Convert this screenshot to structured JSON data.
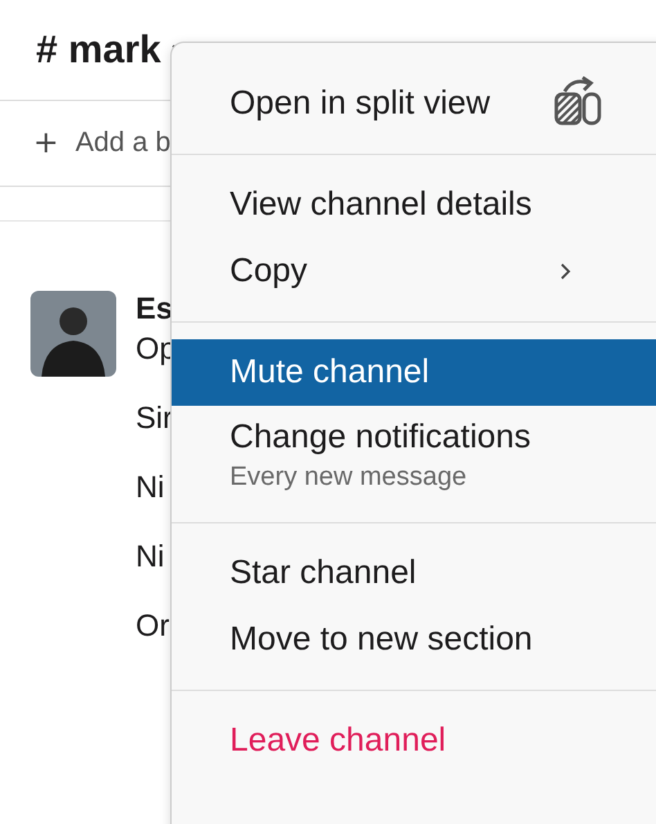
{
  "channel": {
    "title": "# mark"
  },
  "bookmark": {
    "icon": "+",
    "label": "Add a b"
  },
  "message": {
    "author": "Es",
    "lines": [
      "Op",
      "Sir",
      "Ni",
      "Ni",
      "Or"
    ]
  },
  "menu": {
    "items": [
      {
        "kind": "item",
        "label": "Open in split view",
        "selected": false
      },
      {
        "kind": "divider"
      },
      {
        "kind": "item",
        "label": "View channel details",
        "selected": false
      },
      {
        "kind": "item",
        "label": "Copy",
        "submenu": true,
        "selected": false
      },
      {
        "kind": "divider"
      },
      {
        "kind": "item",
        "label": "Mute channel",
        "selected": true
      },
      {
        "kind": "item",
        "label": "Change notifications",
        "sub": "Every new message",
        "selected": false
      },
      {
        "kind": "divider"
      },
      {
        "kind": "item",
        "label": "Star channel",
        "selected": false
      },
      {
        "kind": "item",
        "label": "Move to new section",
        "selected": false
      },
      {
        "kind": "divider"
      },
      {
        "kind": "danger",
        "label": "Leave channel",
        "selected": false
      }
    ]
  }
}
